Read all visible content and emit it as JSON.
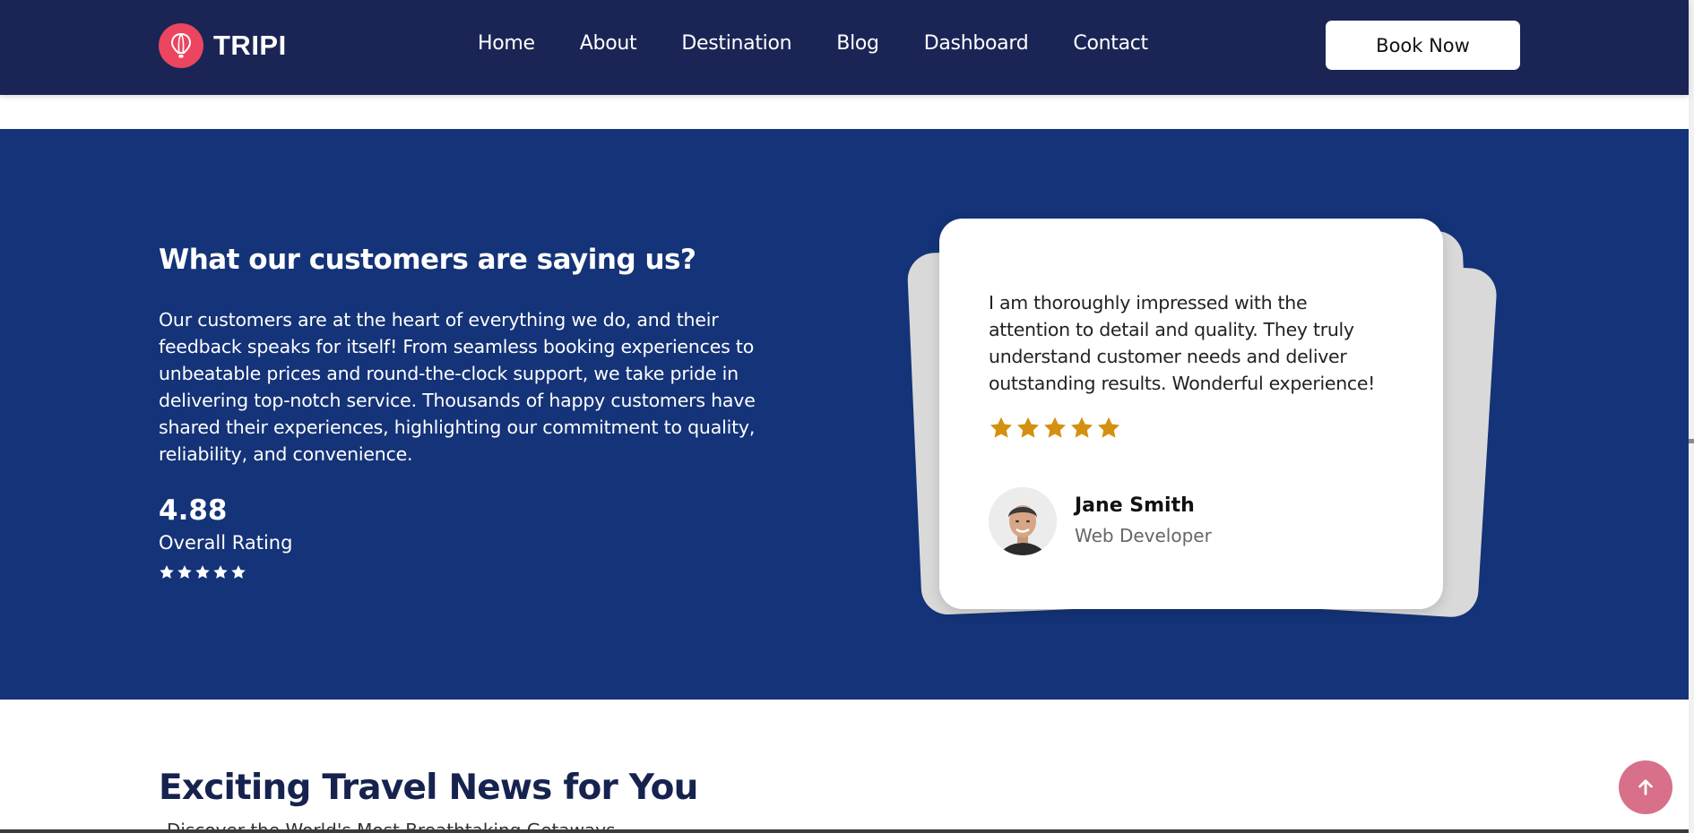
{
  "header": {
    "logo_text": "TRIPI",
    "logo_icon": "hot-air-balloon-icon",
    "nav": [
      "Home",
      "About",
      "Destination",
      "Blog",
      "Dashboard",
      "Contact"
    ],
    "cta_label": "Book Now"
  },
  "testimonials": {
    "title": "What our customers are saying us?",
    "description": "Our customers are at the heart of everything we do, and their feedback speaks for itself! From seamless booking experiences to unbeatable prices and round-the-clock support, we take pride in delivering top-notch service. Thousands of happy customers have shared their experiences, highlighting our commitment to quality, reliability, and convenience.",
    "rating_value": "4.88",
    "rating_label": "Overall Rating",
    "rating_stars": 5,
    "card": {
      "quote": "I am thoroughly impressed with the attention to detail and quality. They truly understand customer needs and deliver outstanding results. Wonderful experience!",
      "stars": 5,
      "author_name": "Jane Smith",
      "author_role": "Web Developer"
    }
  },
  "news": {
    "title": "Exciting Travel News for You",
    "subtitle": "Discover the World's Most Breathtaking Getaways"
  },
  "colors": {
    "header_bg": "#1a2556",
    "section_bg": "#143378",
    "logo_accent": "#ec4560",
    "star_gold": "#d4900e",
    "scroll_button": "#d87089"
  },
  "icons": {
    "scroll_top": "arrow-up-icon",
    "star": "star-icon"
  }
}
